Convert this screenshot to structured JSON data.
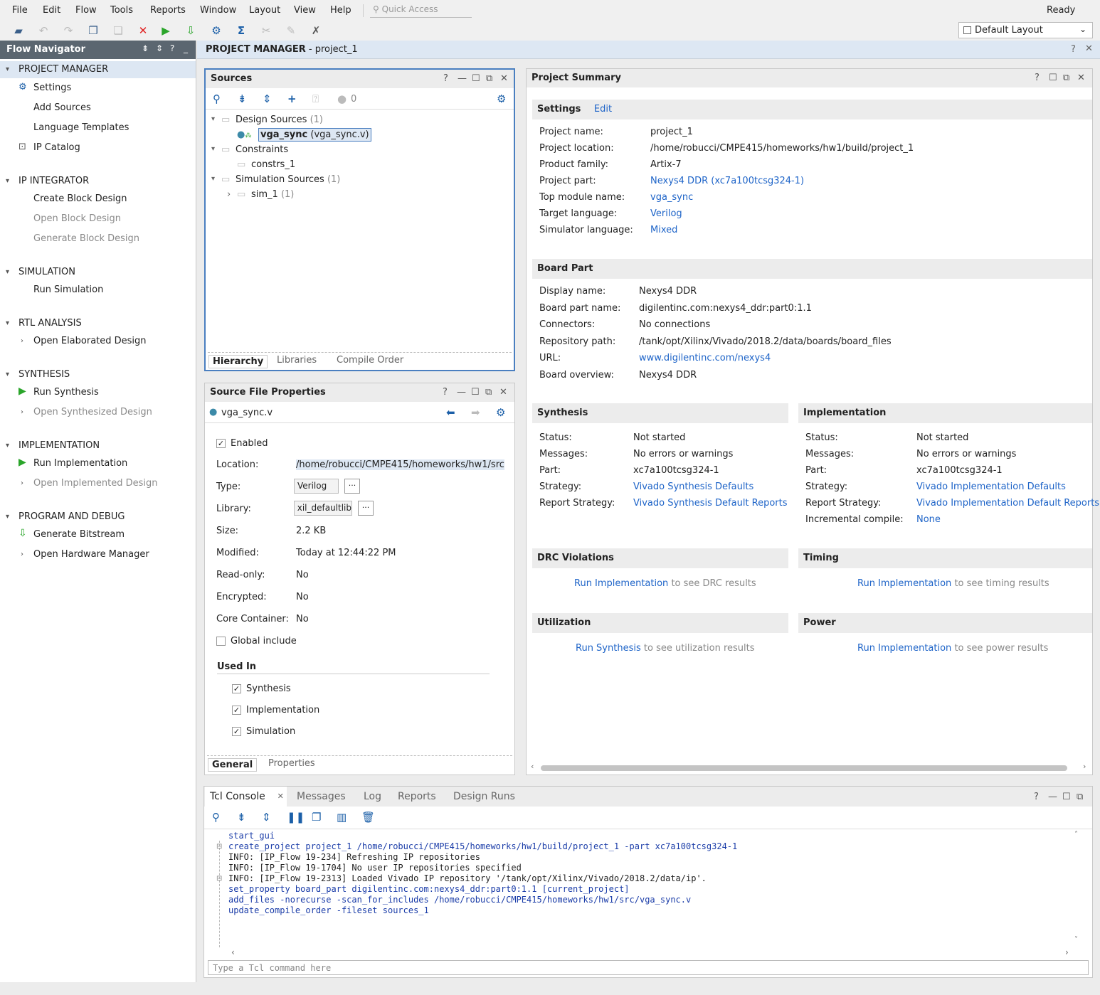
{
  "menu": [
    "File",
    "Edit",
    "Flow",
    "Tools",
    "Reports",
    "Window",
    "Layout",
    "View",
    "Help"
  ],
  "quick_access": {
    "placeholder": "Quick Access"
  },
  "status_text": "Ready",
  "layout_selector": "Default Layout",
  "flow_navigator": {
    "title": "Flow Navigator",
    "sections": [
      {
        "title": "PROJECT MANAGER",
        "items": [
          "Settings",
          "Add Sources",
          "Language Templates",
          "IP Catalog"
        ]
      },
      {
        "title": "IP INTEGRATOR",
        "items": [
          "Create Block Design",
          "Open Block Design",
          "Generate Block Design"
        ]
      },
      {
        "title": "SIMULATION",
        "items": [
          "Run Simulation"
        ]
      },
      {
        "title": "RTL ANALYSIS",
        "items": [
          "Open Elaborated Design"
        ]
      },
      {
        "title": "SYNTHESIS",
        "items": [
          "Run Synthesis",
          "Open Synthesized Design"
        ]
      },
      {
        "title": "IMPLEMENTATION",
        "items": [
          "Run Implementation",
          "Open Implemented Design"
        ]
      },
      {
        "title": "PROGRAM AND DEBUG",
        "items": [
          "Generate Bitstream",
          "Open Hardware Manager"
        ]
      }
    ]
  },
  "main_header": {
    "title": "PROJECT MANAGER",
    "project": "- project_1"
  },
  "sources": {
    "title": "Sources",
    "count": "0",
    "tree": {
      "design_sources": "Design Sources",
      "design_count": "(1)",
      "top_module": "vga_sync",
      "top_file": "(vga_sync.v)",
      "constraints": "Constraints",
      "constrs": "constrs_1",
      "sim_sources": "Simulation Sources",
      "sim_count": "(1)",
      "sim_1": "sim_1",
      "sim_1_count": "(1)"
    },
    "tabs": [
      "Hierarchy",
      "Libraries",
      "Compile Order"
    ]
  },
  "source_file_properties": {
    "title": "Source File Properties",
    "file": "vga_sync.v",
    "enabled_label": "Enabled",
    "location_label": "Location:",
    "location": "/home/robucci/CMPE415/homeworks/hw1/src",
    "type_label": "Type:",
    "type": "Verilog",
    "library_label": "Library:",
    "library": "xil_defaultlib",
    "size_label": "Size:",
    "size": "2.2 KB",
    "modified_label": "Modified:",
    "modified": "Today at 12:44:22 PM",
    "readonly_label": "Read-only:",
    "readonly": "No",
    "encrypted_label": "Encrypted:",
    "encrypted": "No",
    "core_label": "Core Container:",
    "core": "No",
    "global_include": "Global include",
    "used_in": "Used In",
    "used_in_items": [
      "Synthesis",
      "Implementation",
      "Simulation"
    ],
    "tabs": [
      "General",
      "Properties"
    ]
  },
  "project_summary": {
    "title": "Project Summary",
    "settings": {
      "title": "Settings",
      "edit": "Edit",
      "rows": [
        {
          "k": "Project name:",
          "v": "project_1"
        },
        {
          "k": "Project location:",
          "v": "/home/robucci/CMPE415/homeworks/hw1/build/project_1"
        },
        {
          "k": "Product family:",
          "v": "Artix-7"
        },
        {
          "k": "Project part:",
          "v": "Nexys4 DDR (xc7a100tcsg324-1)"
        },
        {
          "k": "Top module name:",
          "v": "vga_sync"
        },
        {
          "k": "Target language:",
          "v": "Verilog"
        },
        {
          "k": "Simulator language:",
          "v": "Mixed"
        }
      ]
    },
    "board_part": {
      "title": "Board Part",
      "rows": [
        {
          "k": "Display name:",
          "v": "Nexys4 DDR"
        },
        {
          "k": "Board part name:",
          "v": "digilentinc.com:nexys4_ddr:part0:1.1"
        },
        {
          "k": "Connectors:",
          "v": "No connections"
        },
        {
          "k": "Repository path:",
          "v": "/tank/opt/Xilinx/Vivado/2018.2/data/boards/board_files"
        },
        {
          "k": "URL:",
          "v": "www.digilentinc.com/nexys4"
        },
        {
          "k": "Board overview:",
          "v": "Nexys4 DDR"
        }
      ]
    },
    "synthesis": {
      "title": "Synthesis",
      "rows": [
        {
          "k": "Status:",
          "v": "Not started"
        },
        {
          "k": "Messages:",
          "v": "No errors or warnings"
        },
        {
          "k": "Part:",
          "v": "xc7a100tcsg324-1"
        },
        {
          "k": "Strategy:",
          "v": "Vivado Synthesis Defaults"
        },
        {
          "k": "Report Strategy:",
          "v": "Vivado Synthesis Default Reports"
        }
      ]
    },
    "implementation": {
      "title": "Implementation",
      "rows": [
        {
          "k": "Status:",
          "v": "Not started"
        },
        {
          "k": "Messages:",
          "v": "No errors or warnings"
        },
        {
          "k": "Part:",
          "v": "xc7a100tcsg324-1"
        },
        {
          "k": "Strategy:",
          "v": "Vivado Implementation Defaults"
        },
        {
          "k": "Report Strategy:",
          "v": "Vivado Implementation Default Reports"
        },
        {
          "k": "Incremental compile:",
          "v": "None"
        }
      ]
    },
    "drc": {
      "title": "DRC Violations",
      "link": "Run Implementation",
      "rest": "to see DRC results"
    },
    "timing": {
      "title": "Timing",
      "link": "Run Implementation",
      "rest": "to see timing results"
    },
    "utilization": {
      "title": "Utilization",
      "link": "Run Synthesis",
      "rest": "to see utilization results"
    },
    "power": {
      "title": "Power",
      "link": "Run Implementation",
      "rest": "to see power results"
    }
  },
  "console": {
    "tabs": [
      "Tcl Console",
      "Messages",
      "Log",
      "Reports",
      "Design Runs"
    ],
    "lines": [
      {
        "t": "start_gui",
        "c": "blue"
      },
      {
        "t": "create_project project_1 /home/robucci/CMPE415/homeworks/hw1/build/project_1 -part xc7a100tcsg324-1",
        "c": "blue"
      },
      {
        "t": "INFO: [IP_Flow 19-234] Refreshing IP repositories",
        "c": "black"
      },
      {
        "t": "INFO: [IP_Flow 19-1704] No user IP repositories specified",
        "c": "black"
      },
      {
        "t": "INFO: [IP_Flow 19-2313] Loaded Vivado IP repository '/tank/opt/Xilinx/Vivado/2018.2/data/ip'.",
        "c": "black"
      },
      {
        "t": "set_property board_part digilentinc.com:nexys4_ddr:part0:1.1 [current_project]",
        "c": "blue"
      },
      {
        "t": "add_files -norecurse -scan_for_includes /home/robucci/CMPE415/homeworks/hw1/src/vga_sync.v",
        "c": "blue"
      },
      {
        "t": "update_compile_order -fileset sources_1",
        "c": "blue"
      }
    ],
    "input_placeholder": "Type a Tcl command here"
  },
  "colors": {
    "link": "#1e64c8",
    "header": "#5b6670",
    "selection": "#dde7f3"
  }
}
